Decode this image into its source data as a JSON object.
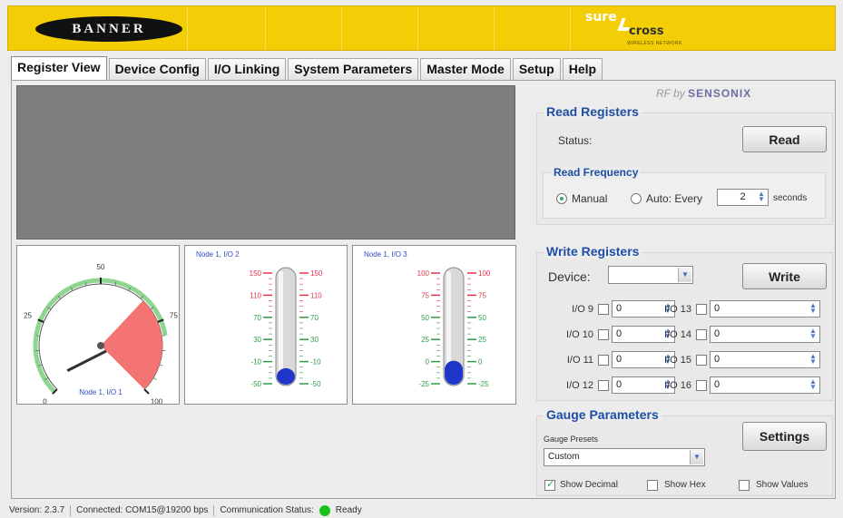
{
  "header": {
    "brand_left": "BANNER",
    "brand_right_top": "sure",
    "brand_right_bottom": "cross",
    "brand_right_tag": "WIRELESS NETWORK",
    "bar_color": "#f3cd06"
  },
  "tabs": [
    {
      "label": "Register View",
      "active": true
    },
    {
      "label": "Device Config"
    },
    {
      "label": "I/O Linking"
    },
    {
      "label": "System Parameters"
    },
    {
      "label": "Master Mode"
    },
    {
      "label": "Setup"
    },
    {
      "label": "Help"
    }
  ],
  "rf_badge": {
    "prefix": "RF by",
    "name": "SENSONIX"
  },
  "read_registers": {
    "title": "Read Registers",
    "status_label": "Status:",
    "read_button": "Read",
    "frequency": {
      "title": "Read Frequency",
      "manual_label": "Manual",
      "manual_selected": true,
      "auto_label": "Auto: Every",
      "interval": "2",
      "unit": "seconds"
    }
  },
  "write_registers": {
    "title": "Write Registers",
    "device_label": "Device:",
    "device_value": "",
    "write_button": "Write",
    "io": [
      {
        "label": "I/O 9",
        "value": "0",
        "checked": false
      },
      {
        "label": "I/O 10",
        "value": "0",
        "checked": false
      },
      {
        "label": "I/O 11",
        "value": "0",
        "checked": false
      },
      {
        "label": "I/O 12",
        "value": "0",
        "checked": false
      },
      {
        "label": "I/O 13",
        "value": "0",
        "checked": false
      },
      {
        "label": "I/O 14",
        "value": "0",
        "checked": false
      },
      {
        "label": "I/O 15",
        "value": "0",
        "checked": false
      },
      {
        "label": "I/O 16",
        "value": "0",
        "checked": false
      }
    ]
  },
  "gauge_parameters": {
    "title": "Gauge Parameters",
    "presets_label": "Gauge Presets",
    "preset_value": "Custom",
    "settings_button": "Settings",
    "show_decimal": {
      "label": "Show Decimal",
      "checked": true
    },
    "show_hex": {
      "label": "Show Hex",
      "checked": false
    },
    "show_values": {
      "label": "Show Values",
      "checked": false
    }
  },
  "gauges": {
    "dial": {
      "caption": "Node 1, I/O 1",
      "ticks": [
        "0",
        "25",
        "50",
        "75",
        "100"
      ],
      "min": 0,
      "max": 100,
      "value": 3,
      "alarm_from": 66,
      "alarm_to": 100,
      "green_from": 0,
      "green_to": 80
    },
    "thermo1": {
      "caption": "Node 1, I/O 2",
      "ticks_red": [
        "150",
        "110"
      ],
      "ticks_green": [
        "70",
        "30",
        "-10",
        "-50"
      ],
      "min": -50,
      "max": 150,
      "value": -22
    },
    "thermo2": {
      "caption": "Node 1, I/O 3",
      "ticks_red": [
        "100",
        "75"
      ],
      "ticks_green": [
        "50",
        "25",
        "0",
        "-25"
      ],
      "min": -25,
      "max": 100,
      "value": 1
    }
  },
  "status_bar": {
    "version": "Version: 2.3.7",
    "connection": "Connected: COM15@19200 bps",
    "comm_label": "Communication Status:",
    "comm_state": "Ready",
    "led_color": "#19c419"
  }
}
